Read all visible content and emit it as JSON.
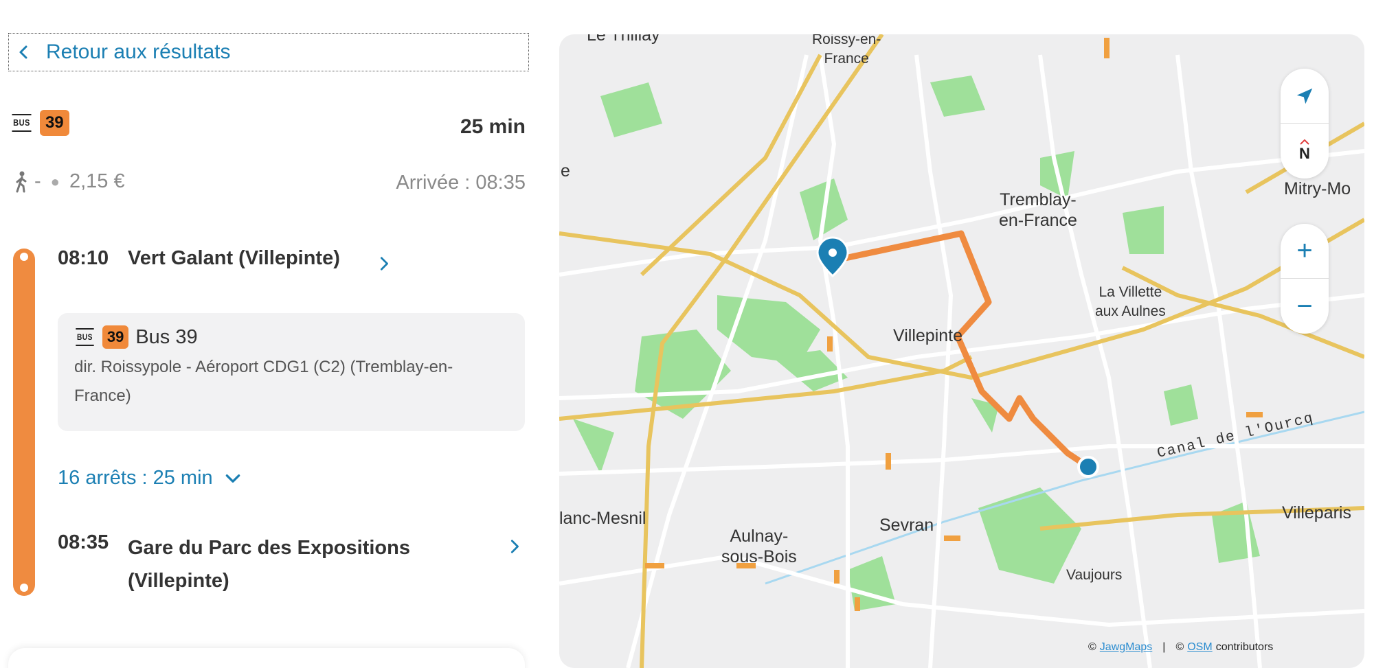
{
  "back": {
    "label": "Retour aux résultats"
  },
  "journey": {
    "bus_logo": "BUS",
    "line": "39",
    "duration": "25 min",
    "walk_dash": "-",
    "price": "2,15 €",
    "arrival": "Arrivée : 08:35"
  },
  "departure": {
    "time": "08:10",
    "name": "Vert Galant (Villepinte)"
  },
  "bus_card": {
    "bus_logo": "BUS",
    "line": "39",
    "title": "Bus 39",
    "direction": "dir. Roissypole - Aéroport CDG1 (C2) (Tremblay-en-France)"
  },
  "stops_toggle": {
    "label": "16 arrêts : 25 min"
  },
  "arrival_stop": {
    "time": "08:35",
    "name_line1": "Gare du Parc des Expositions",
    "name_line2": "(Villepinte)"
  },
  "map": {
    "labels": {
      "le_thillay": "Le Thillay",
      "roissy": "Roissy-en-\nFrance",
      "e": "e",
      "tremblay": "Tremblay-\nen-France",
      "mitry": "Mitry-Mo",
      "la_villette": "La Villette\naux Aulnes",
      "villepinte": "Villepinte",
      "canal": "Canal de l'Ourcq",
      "blanc_mesnil": "lanc-Mesnil",
      "aulnay": "Aulnay-\nsous-Bois",
      "sevran": "Sevran",
      "villeparisis": "Villeparis",
      "vaujours": "Vaujours"
    },
    "zoom_in": "+",
    "zoom_out": "−",
    "compass": "N",
    "attribution": {
      "prefix": "©",
      "jawg": "JawgMaps",
      "sep": "|",
      "osm_prefix": "©",
      "osm": "OSM",
      "contributors": "contributors"
    }
  },
  "colors": {
    "accent": "#1b7fb3",
    "line_orange": "#f0893a",
    "route_orange": "#ef8b40"
  }
}
